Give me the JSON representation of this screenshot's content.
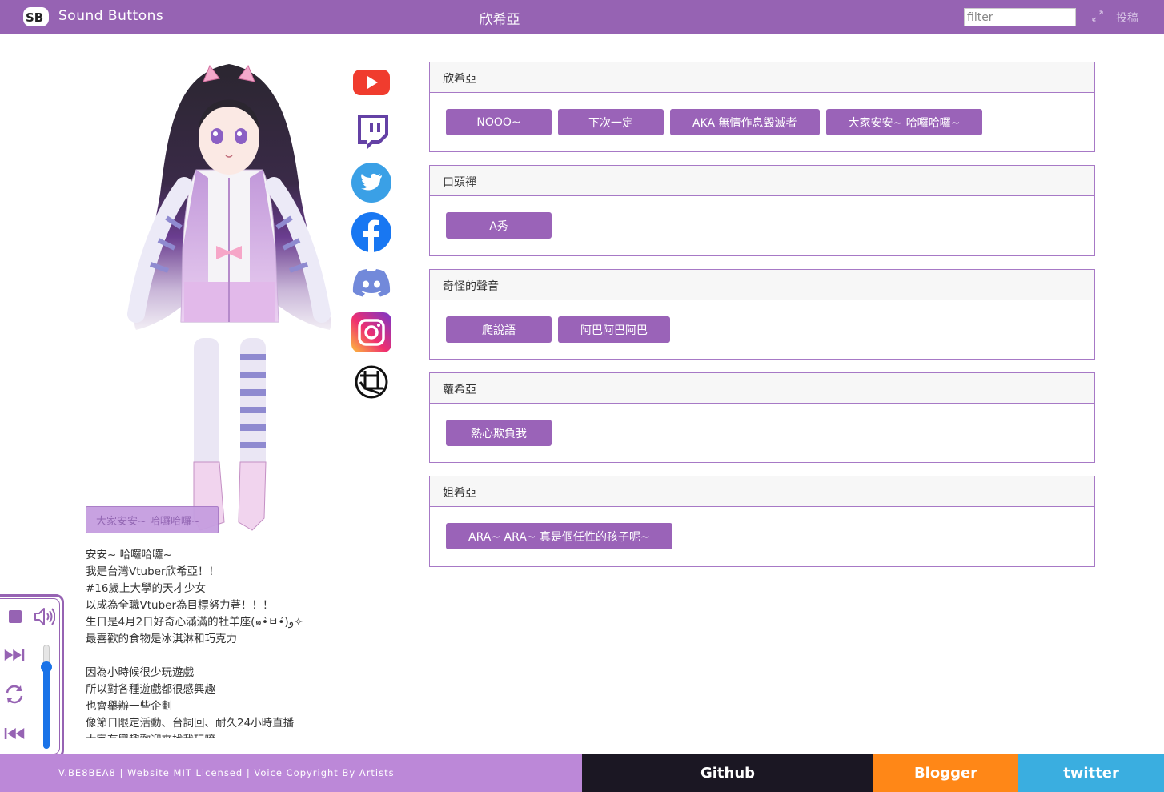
{
  "header": {
    "brand": "Sound Buttons",
    "title": "欣希亞",
    "filter_placeholder": "filter",
    "submit_label": "投稿"
  },
  "now_playing": "大家安安~ 哈囉哈囉~",
  "bio": "安安~ 哈囉哈囉~\n我是台灣Vtuber欣希亞！！\n#16歲上大學的天才少女\n以成為全職Vtuber為目標努力著！！！\n生日是4月2日好奇心滿滿的牡羊座(๑•̀ㅂ•́)و✧\n最喜歡的食物是冰淇淋和巧克力\n\n因為小時候很少玩遊戲\n所以對各種遊戲都很感興趣\n也會舉辦一些企劃\n像節日限定活動、台詞回、耐久24小時直播\n大家有興趣歡迎來找我玩唷",
  "social": [
    "youtube-icon",
    "twitch-icon",
    "twitter-icon",
    "facebook-icon",
    "discord-icon",
    "instagram-icon",
    "website-icon"
  ],
  "categories": [
    {
      "title": "欣希亞",
      "buttons": [
        "NOOO~",
        "下次一定",
        "AKA 無情作息毀滅者",
        "大家安安~ 哈囉哈囉~"
      ]
    },
    {
      "title": "口頭禪",
      "buttons": [
        "A秀"
      ]
    },
    {
      "title": "奇怪的聲音",
      "buttons": [
        "爬說語",
        "阿巴阿巴阿巴"
      ]
    },
    {
      "title": "蘿希亞",
      "buttons": [
        "熱心欺負我"
      ]
    },
    {
      "title": "姐希亞",
      "buttons": [
        "ARA~ ARA~ 真是個任性的孩子呢~"
      ]
    }
  ],
  "player": {
    "volume": 0.78
  },
  "footer": {
    "license": "V.BE8BEA8 | Website MIT Licensed | Voice Copyright By Artists",
    "github": "Github",
    "blogger": "Blogger",
    "twitter": "twitter"
  },
  "colors": {
    "accent": "#9663b3",
    "button": "#9a63b8",
    "footer_license": "#bc88d8",
    "github": "#1b1723",
    "blogger": "#ff8717",
    "twitter": "#3aaee0"
  }
}
